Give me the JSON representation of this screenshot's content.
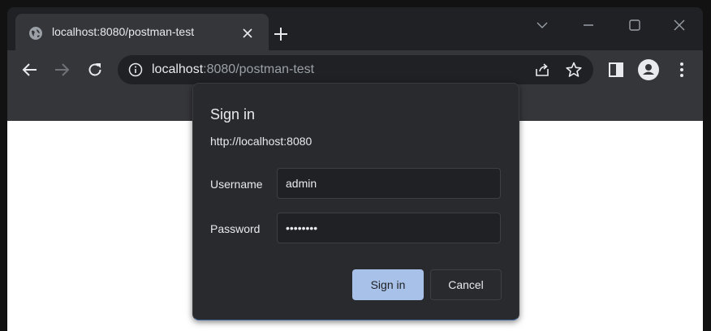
{
  "tab": {
    "title": "localhost:8080/postman-test",
    "favicon": "globe-icon",
    "close_icon": "close-icon"
  },
  "tabstrip": {
    "new_tab_icon": "plus-icon",
    "controls": [
      "chevron-down-icon",
      "minimize-icon",
      "maximize-icon",
      "close-icon"
    ]
  },
  "toolbar": {
    "back_icon": "arrow-left-icon",
    "forward_icon": "arrow-right-icon",
    "reload_icon": "reload-icon",
    "url_host": "localhost",
    "url_rest": ":8080/postman-test",
    "site_info_icon": "info-icon",
    "share_icon": "share-icon",
    "bookmark_icon": "star-icon",
    "side_panel_icon": "side-panel-icon",
    "profile_icon": "profile-icon",
    "menu_icon": "kebab-menu-icon"
  },
  "dialog": {
    "title": "Sign in",
    "origin": "http://localhost:8080",
    "username_label": "Username",
    "username_value": "admin",
    "password_label": "Password",
    "password_value": "admin123",
    "sign_in_label": "Sign in",
    "cancel_label": "Cancel"
  },
  "colors": {
    "chrome_dark": "#202124",
    "toolbar": "#35363a",
    "dialog_bg": "#292a2d",
    "primary_button": "#a8c1e8",
    "text": "#e8eaed"
  }
}
